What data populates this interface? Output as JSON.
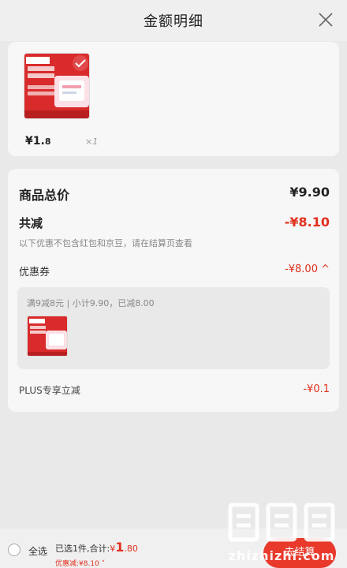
{
  "header": {
    "title": "金额明细"
  },
  "product": {
    "price_main": "¥1.",
    "price_cents": "8",
    "quantity": "×1"
  },
  "details": {
    "total_label": "商品总价",
    "total_value": "¥9.90",
    "reduce_label": "共减",
    "reduce_value": "-¥8.10",
    "note": "以下优惠不包含红包和京豆，请在结算页查看",
    "coupon_label": "优惠券",
    "coupon_value": "-¥8.00 ^",
    "coupon_desc": "满9减8元 | 小计9.90，已减8.00",
    "plus_label": "PLUS专享立减",
    "plus_value": "-¥0.1"
  },
  "bottom": {
    "select_all": "全选",
    "summary_prefix": "已选1件,合计:",
    "summary_yen": "¥",
    "summary_big": "1",
    "summary_tail": ".80",
    "discount": "优惠减:¥8.10 ˅",
    "checkout": "去结算"
  },
  "watermark": {
    "text": "zhizhizhi.com"
  },
  "colors": {
    "accent": "#e0301e",
    "checkout": "#e8392b"
  }
}
